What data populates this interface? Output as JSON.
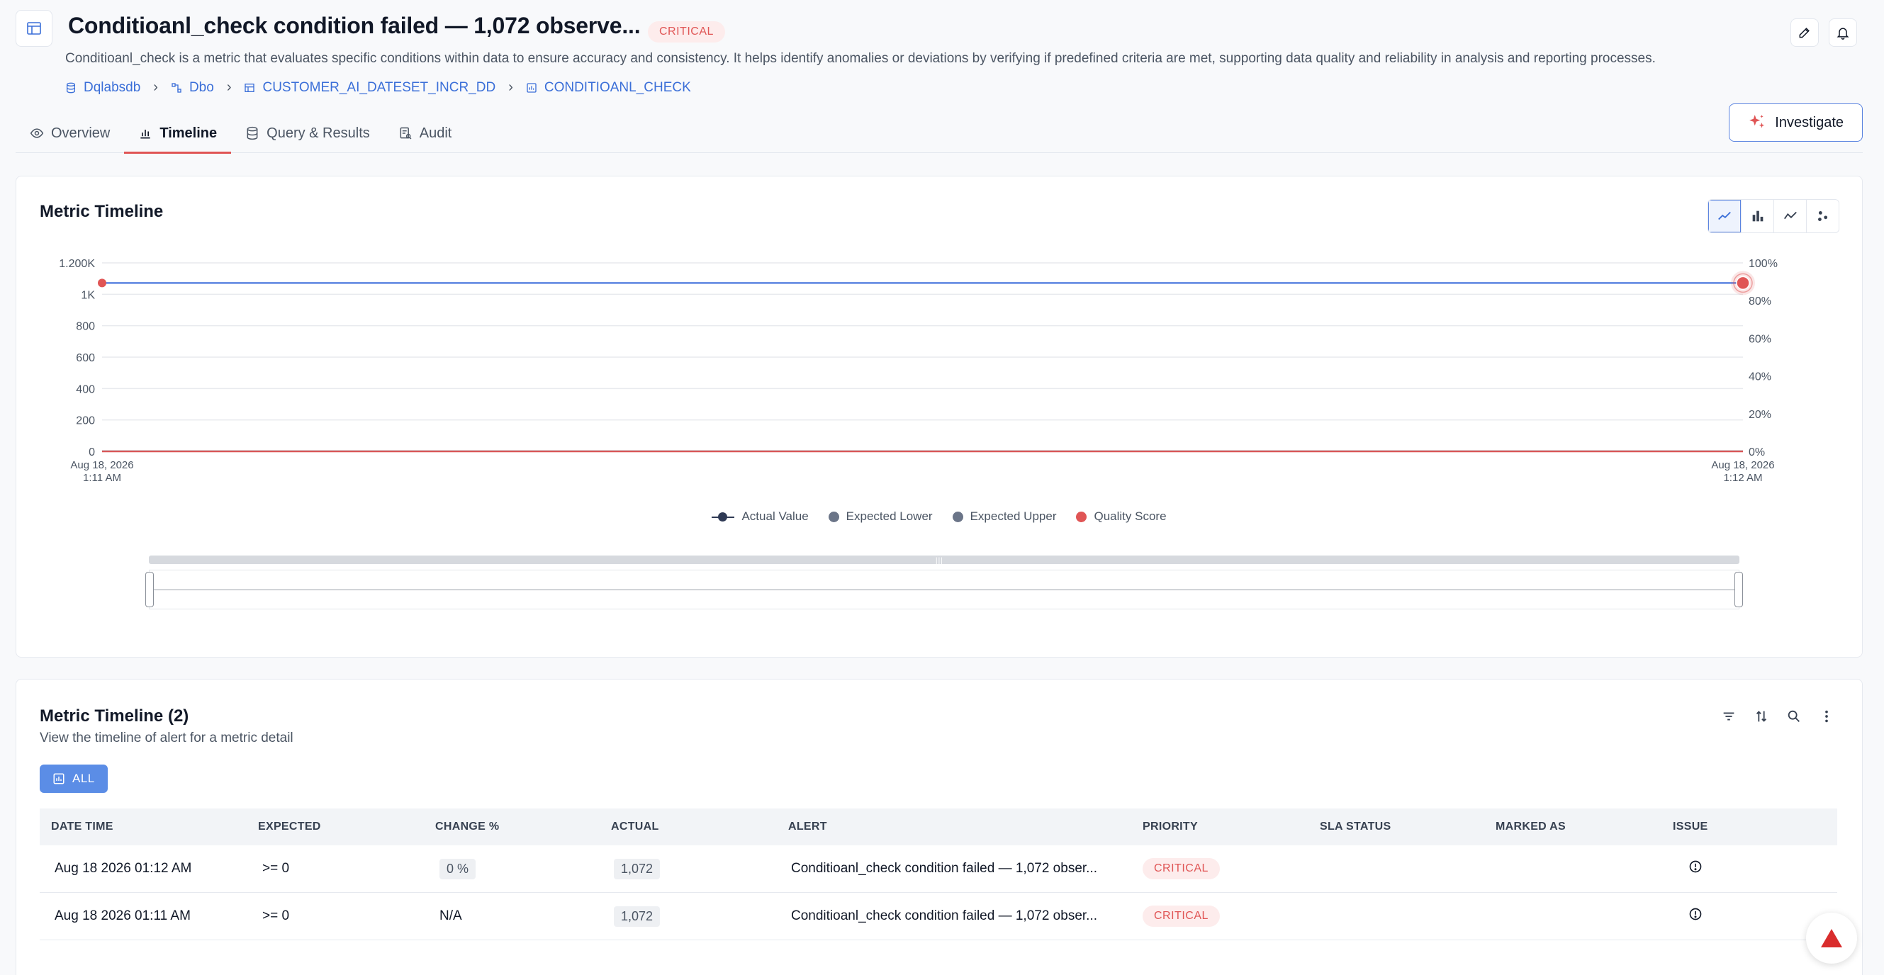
{
  "header": {
    "title": "Conditioanl_check condition failed — 1,072 observe...",
    "badge": "CRITICAL",
    "description": "Conditioanl_check is a metric that evaluates specific conditions within data to ensure accuracy and consistency. It helps identify anomalies or deviations by verifying if predefined criteria are met, supporting data quality and reliability in analysis and reporting processes.",
    "breadcrumb": [
      {
        "label": "Dqlabsdb",
        "icon": "database-icon"
      },
      {
        "label": "Dbo",
        "icon": "schema-icon"
      },
      {
        "label": "CUSTOMER_AI_DATESET_INCR_DD",
        "icon": "table-icon"
      },
      {
        "label": "CONDITIOANL_CHECK",
        "icon": "metric-icon"
      }
    ],
    "actions": [
      "edit-icon",
      "bell-icon"
    ]
  },
  "tabs": [
    {
      "label": "Overview",
      "icon": "eye-icon",
      "active": false
    },
    {
      "label": "Timeline",
      "icon": "bar-chart-icon",
      "active": true
    },
    {
      "label": "Query & Results",
      "icon": "database-icon",
      "active": false
    },
    {
      "label": "Audit",
      "icon": "audit-icon",
      "active": false
    }
  ],
  "investigate_label": "Investigate",
  "chart_card": {
    "title": "Metric Timeline",
    "view_toggles": [
      "line-chart-icon",
      "bar-chart-icon",
      "trend-icon",
      "scatter-icon"
    ]
  },
  "chart_data": {
    "type": "line",
    "x": [
      "Aug 18, 2026 1:11 AM",
      "Aug 18, 2026 1:12 AM"
    ],
    "x_tick_labels": [
      [
        "Aug 18, 2026",
        "1:11 AM"
      ],
      [
        "Aug 18, 2026",
        "1:12 AM"
      ]
    ],
    "y_left_ticks": [
      "0",
      "200",
      "400",
      "600",
      "800",
      "1K",
      "1.200K"
    ],
    "y_left_tick_values": [
      0,
      200,
      400,
      600,
      800,
      1000,
      1200
    ],
    "y_right_ticks": [
      "0%",
      "20%",
      "40%",
      "60%",
      "80%",
      "100%"
    ],
    "ylim": [
      0,
      1200
    ],
    "y2lim": [
      0,
      100
    ],
    "grid": true,
    "legend_position": "bottom",
    "series": [
      {
        "name": "Actual Value",
        "values": [
          1072,
          1072
        ],
        "color": "#5b84e0"
      },
      {
        "name": "Expected Lower",
        "values": [
          0,
          0
        ],
        "color": "#6b7588"
      },
      {
        "name": "Expected Upper",
        "values": [],
        "color": "#6b7588"
      },
      {
        "name": "Quality Score",
        "values": [
          0,
          0
        ],
        "color": "#e05555"
      }
    ]
  },
  "table_card": {
    "title": "Metric Timeline (2)",
    "subtitle": "View the timeline of alert for a metric detail",
    "filter_chip": "ALL",
    "actions": [
      "filter-icon",
      "sort-icon",
      "search-icon",
      "more-icon"
    ],
    "columns": [
      "DATE TIME",
      "EXPECTED",
      "CHANGE %",
      "ACTUAL",
      "ALERT",
      "PRIORITY",
      "SLA STATUS",
      "MARKED AS",
      "ISSUE"
    ],
    "rows": [
      {
        "date_time": "Aug 18 2026 01:12 AM",
        "expected": ">= 0",
        "change": "0 %",
        "actual": "1,072",
        "alert": "Conditioanl_check condition failed — 1,072 obser...",
        "priority": "CRITICAL",
        "sla_status": "",
        "marked_as": ""
      },
      {
        "date_time": "Aug 18 2026 01:11 AM",
        "expected": ">= 0",
        "change": "N/A",
        "actual": "1,072",
        "alert": "Conditioanl_check condition failed — 1,072 obser...",
        "priority": "CRITICAL",
        "sla_status": "",
        "marked_as": ""
      }
    ]
  },
  "colors": {
    "accent": "#5b84e0",
    "critical": "#e05555",
    "critical_bg": "#fdecec"
  }
}
